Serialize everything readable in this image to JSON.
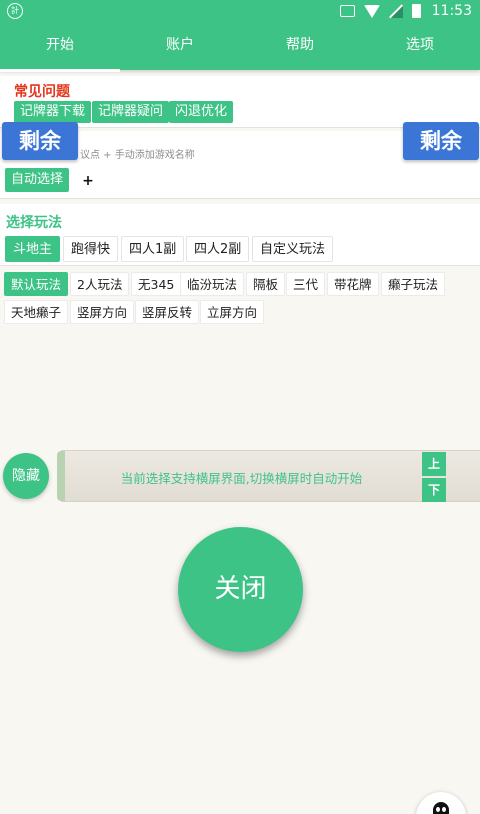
{
  "statusbar": {
    "time": "11:53",
    "app_icon_text": "計"
  },
  "tabs": [
    {
      "label": "开始",
      "active": true
    },
    {
      "label": "账户"
    },
    {
      "label": "帮助"
    },
    {
      "label": "选项"
    }
  ],
  "faq": {
    "title": "常见问题",
    "items": [
      "记牌器下载",
      "记牌器疑问",
      "闪退优化"
    ]
  },
  "game_select": {
    "hint": "议点 + 手动添加游戏名称",
    "auto_label": "自动选择",
    "add_label": "+"
  },
  "remaining_label": "剩余",
  "play_mode": {
    "title": "选择玩法",
    "options": [
      "斗地主",
      "跑得快",
      "四人1副",
      "四人2副",
      "自定义玩法"
    ],
    "selected": "斗地主"
  },
  "rules": {
    "row1": [
      "默认玩法",
      "2人玩法",
      "无345",
      "临汾玩法",
      "隔板",
      "三代",
      "带花牌",
      "癞子玩法"
    ],
    "row2": [
      "天地癞子",
      "竖屏方向",
      "竖屏反转",
      "立屏方向"
    ],
    "selected": "默认玩法"
  },
  "scroll_bar": {
    "text": "当前选择支持横屏界面,切换横屏时自动开始",
    "up_label": "上",
    "down_label": "下"
  },
  "hide_label": "隐藏",
  "close_label": "关闭",
  "colors": {
    "primary": "#3ec387",
    "accent_red": "#e4361b",
    "remain_blue": "#3b76d7"
  },
  "icons": {
    "qq": "qq-penguin-icon"
  }
}
